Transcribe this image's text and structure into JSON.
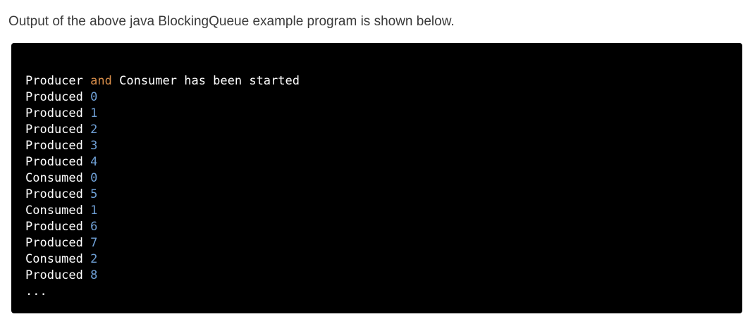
{
  "intro_text": "Output of the above java BlockingQueue example program is shown below.",
  "colors": {
    "background": "#000000",
    "text": "#ffffff",
    "keyword": "#d98e4a",
    "number": "#6fa0d6"
  },
  "output": {
    "header": {
      "word1": "Producer",
      "keyword": "and",
      "rest": "Consumer has been started"
    },
    "lines": [
      {
        "label": "Produced",
        "value": "0"
      },
      {
        "label": "Produced",
        "value": "1"
      },
      {
        "label": "Produced",
        "value": "2"
      },
      {
        "label": "Produced",
        "value": "3"
      },
      {
        "label": "Produced",
        "value": "4"
      },
      {
        "label": "Consumed",
        "value": "0"
      },
      {
        "label": "Produced",
        "value": "5"
      },
      {
        "label": "Consumed",
        "value": "1"
      },
      {
        "label": "Produced",
        "value": "6"
      },
      {
        "label": "Produced",
        "value": "7"
      },
      {
        "label": "Consumed",
        "value": "2"
      },
      {
        "label": "Produced",
        "value": "8"
      }
    ],
    "ellipsis": "..."
  }
}
